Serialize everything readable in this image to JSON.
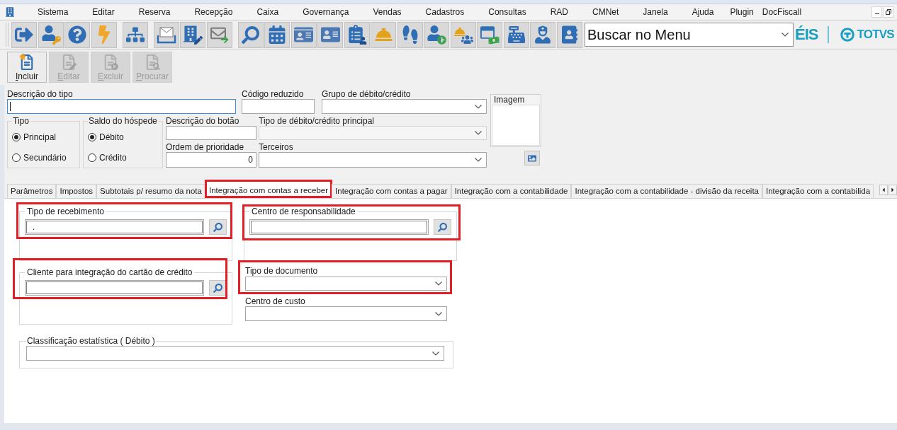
{
  "menu": {
    "items": [
      "Sistema",
      "Editar",
      "Reserva",
      "Recepção",
      "Caixa",
      "Governança",
      "Vendas",
      "Cadastros",
      "Consultas",
      "RAD",
      "CMNet",
      "Janela",
      "Ajuda",
      "Plugin",
      "DocFiscall"
    ]
  },
  "toolbar": {
    "search": {
      "value": "Buscar no Menu"
    },
    "brand": {
      "partial_text": "ÉIS",
      "logo_text": "TOTVS"
    }
  },
  "actions": [
    {
      "label": "Incluir",
      "disabled": false
    },
    {
      "label": "Editar",
      "disabled": true
    },
    {
      "label": "Excluir",
      "disabled": true
    },
    {
      "label": "Procurar",
      "disabled": true
    }
  ],
  "form": {
    "descricao_tipo": {
      "label": "Descrição do tipo",
      "focused": true
    },
    "codigo_reduzido": {
      "label": "Código reduzido"
    },
    "grupo": {
      "label": "Grupo de débito/crédito"
    },
    "imagem": {
      "label": "Imagem"
    },
    "tipo": {
      "label": "Tipo",
      "options": [
        {
          "label": "Principal",
          "selected": true
        },
        {
          "label": "Secundário",
          "selected": false
        }
      ]
    },
    "saldo_hospede": {
      "label": "Saldo do hóspede",
      "options": [
        {
          "label": "Débito",
          "selected": true
        },
        {
          "label": "Crédito",
          "selected": false
        }
      ]
    },
    "descricao_botao": {
      "label": "Descrição do botão"
    },
    "tipo_principal": {
      "label": "Tipo de débito/crédito principal",
      "disabled": true
    },
    "ordem_prioridade": {
      "label": "Ordem de prioridade",
      "value": "0"
    },
    "terceiros": {
      "label": "Terceiros"
    }
  },
  "tabs": [
    {
      "label": "Parâmetros",
      "selected": false,
      "highlighted": false
    },
    {
      "label": "Impostos",
      "selected": false,
      "highlighted": false
    },
    {
      "label": "Subtotais p/ resumo da nota",
      "selected": false,
      "highlighted": false
    },
    {
      "label": "Integração com contas a receber",
      "selected": true,
      "highlighted": true
    },
    {
      "label": "Integração com contas a pagar",
      "selected": false,
      "highlighted": false
    },
    {
      "label": "Integração com a contabilidade",
      "selected": false,
      "highlighted": false
    },
    {
      "label": "Integração com a contabilidade - divisão da receita",
      "selected": false,
      "highlighted": false
    },
    {
      "label": "Integração com a contabilida",
      "selected": false,
      "highlighted": false
    }
  ],
  "tab_panel": {
    "tipo_recebimento": {
      "label": "Tipo de recebimento",
      "value": ".",
      "highlighted": true
    },
    "centro_responsabilidade": {
      "label": "Centro de responsabilidade",
      "highlighted": true
    },
    "cliente_cartao": {
      "label": "Cliente para integração do cartão de crédito",
      "highlighted": true
    },
    "tipo_documento": {
      "label": "Tipo de documento",
      "highlighted": true
    },
    "centro_custo": {
      "label": "Centro de custo"
    },
    "classificacao": {
      "label": "Classificação estatística ( Débito )"
    }
  }
}
